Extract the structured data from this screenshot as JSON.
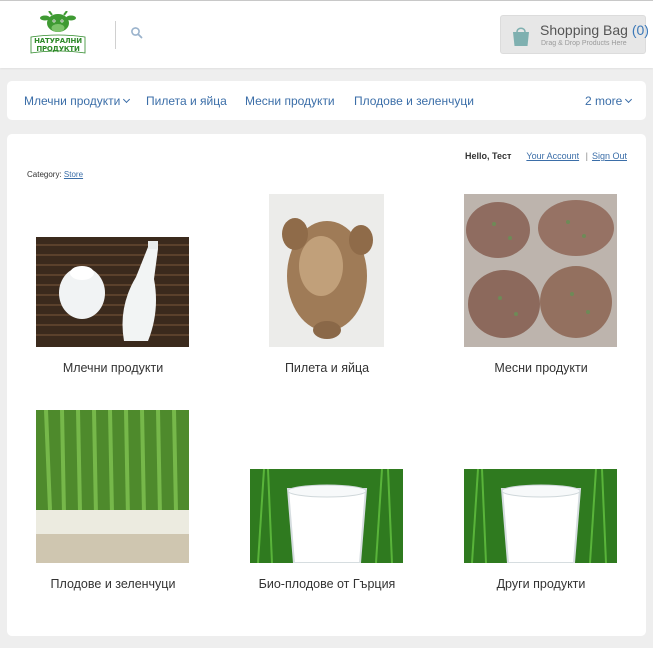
{
  "header": {
    "logo_text_line1": "НАТУРАЛНИ",
    "logo_text_line2": "ПРОДУКТИ",
    "search_icon": "search-icon",
    "bag": {
      "title": "Shopping Bag",
      "count": "(0)",
      "subtitle": "Drag & Drop Products Here",
      "icon": "shopping-bag-icon"
    }
  },
  "nav": {
    "items": [
      {
        "label": "Млечни продукти"
      },
      {
        "label": "Пилета и яйца"
      },
      {
        "label": "Месни продукти"
      },
      {
        "label": "Плодове и зеленчуци"
      }
    ],
    "more_label": "2 more"
  },
  "account": {
    "hello": "Hello, Тест",
    "your_account": "Your Account",
    "separator": "|",
    "sign_out": "Sign Out"
  },
  "category": {
    "prefix": "Category:",
    "link": "Store"
  },
  "tiles": [
    {
      "label": "Млечни продукти"
    },
    {
      "label": "Пилета и яйца"
    },
    {
      "label": "Месни продукти"
    },
    {
      "label": "Плодове и зеленчуци"
    },
    {
      "label": "Био-плодове от Гърция"
    },
    {
      "label": "Други продукти"
    }
  ],
  "colors": {
    "link": "#3b6ea8",
    "brand_green": "#2f8a2a",
    "bag_count": "#3b78b8"
  }
}
